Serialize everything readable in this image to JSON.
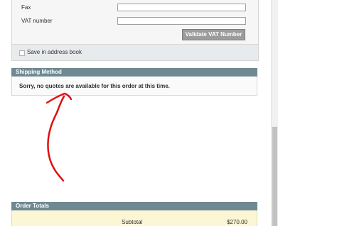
{
  "billing_address": {
    "fax_label": "Fax",
    "fax_value": "",
    "vat_label": "VAT number",
    "vat_value": "",
    "validate_vat_label": "Validate VAT Number",
    "save_in_address_book_label": "Save in address book",
    "save_in_address_book_checked": false
  },
  "shipping_method": {
    "title": "Shipping Method",
    "message": "Sorry, no quotes are available for this order at this time."
  },
  "order_totals": {
    "title": "Order Totals",
    "subtotal_label": "Subtotal",
    "subtotal_value": "$270.00"
  },
  "annotation": {
    "description": "red-arrow-pointing-up",
    "color": "#e01010"
  },
  "colors": {
    "section_header": "#6f8992",
    "totals_background": "#fbf6d4",
    "panel_background": "#f6f6f6"
  }
}
